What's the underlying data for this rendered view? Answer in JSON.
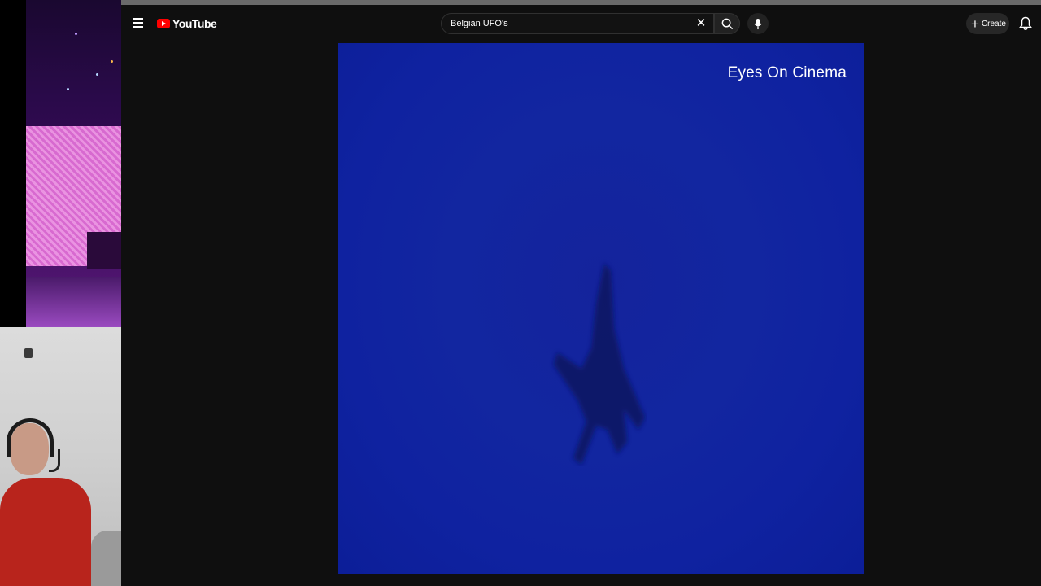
{
  "youtube": {
    "logo_text": "YouTube",
    "search": {
      "value": "Belgian UFO's"
    },
    "create_label": "Create"
  },
  "video": {
    "watermark": "Eyes On Cinema"
  },
  "colors": {
    "youtube_red": "#ff0000",
    "video_blue": "#1226a0",
    "masthead": "#0f0f0f"
  },
  "icons": [
    "menu-icon",
    "youtube-logo-icon",
    "clear-icon",
    "search-icon",
    "mic-icon",
    "plus-icon",
    "bell-icon"
  ]
}
